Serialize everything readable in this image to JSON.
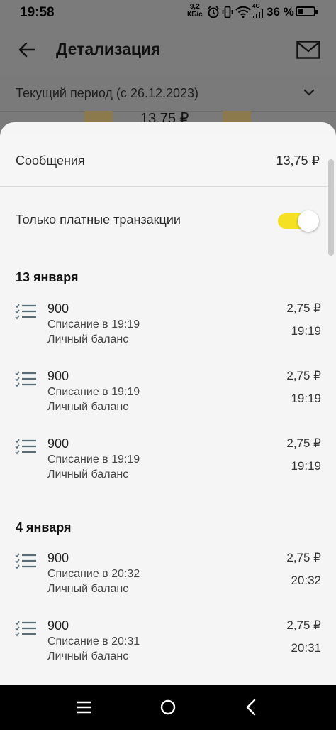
{
  "status_bar": {
    "time": "19:58",
    "net_speed_value": "9,2",
    "net_speed_unit": "КБ/с",
    "network_type": "4G",
    "battery_percent": "36 %",
    "battery_level": 0.36
  },
  "header": {
    "title": "Детализация",
    "back_icon": "arrow-left-icon",
    "mail_icon": "envelope-icon"
  },
  "period": {
    "label": "Текущий период (с 26.12.2023)",
    "amount_peek": "13,75 ₽"
  },
  "sheet": {
    "summary": {
      "label": "Сообщения",
      "value": "13,75 ₽"
    },
    "paid_only": {
      "label": "Только платные транзакции",
      "enabled": true
    },
    "groups": [
      {
        "date": "13 января",
        "items": [
          {
            "number": "900",
            "description": "Списание в 19:19",
            "source": "Личный баланс",
            "amount": "2,75 ₽",
            "time": "19:19"
          },
          {
            "number": "900",
            "description": "Списание в 19:19",
            "source": "Личный баланс",
            "amount": "2,75 ₽",
            "time": "19:19"
          },
          {
            "number": "900",
            "description": "Списание в 19:19",
            "source": "Личный баланс",
            "amount": "2,75 ₽",
            "time": "19:19"
          }
        ]
      },
      {
        "date": "4 января",
        "items": [
          {
            "number": "900",
            "description": "Списание в 20:32",
            "source": "Личный баланс",
            "amount": "2,75 ₽",
            "time": "20:32"
          },
          {
            "number": "900",
            "description": "Списание в 20:31",
            "source": "Личный баланс",
            "amount": "2,75 ₽",
            "time": "20:31"
          }
        ]
      }
    ]
  },
  "colors": {
    "toggle_on": "#f6e024",
    "icon_slate": "#5a6e7a",
    "dim_overlay": "#7a7a7a"
  }
}
